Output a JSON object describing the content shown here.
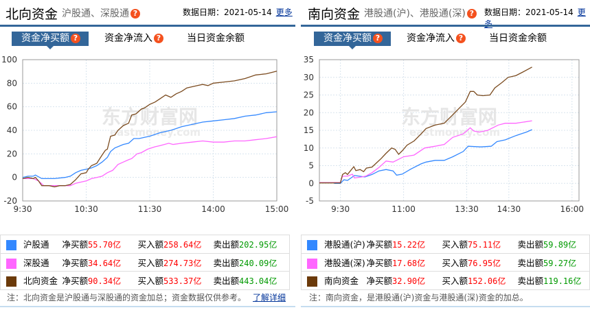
{
  "north": {
    "title": "北向资金",
    "subtitle": "沪股通、深股通",
    "date_label": "数据日期：2021-05-14",
    "more": "更多",
    "tabs": [
      "资金净买额",
      "资金净流入",
      "当日资金余额"
    ],
    "legend": [
      {
        "name": "沪股通",
        "net_label": "净买额",
        "net": "55.70亿",
        "buy_label": "买入额",
        "buy": "258.64亿",
        "sell_label": "卖出额",
        "sell": "202.95亿",
        "color": "#3388ff"
      },
      {
        "name": "深股通",
        "net_label": "净买额",
        "net": "34.64亿",
        "buy_label": "买入额",
        "buy": "274.73亿",
        "sell_label": "卖出额",
        "sell": "240.09亿",
        "color": "#ff66ff"
      },
      {
        "name": "北向资金",
        "net_label": "净买额",
        "net": "90.34亿",
        "buy_label": "买入额",
        "buy": "533.37亿",
        "sell_label": "卖出额",
        "sell": "443.04亿",
        "color": "#6b3a0a"
      }
    ],
    "note": "注：北向资金是沪股通与深股通的资金加总；资金数据仅供参考。",
    "note_link": "了解详细"
  },
  "south": {
    "title": "南向资金",
    "subtitle": "港股通(沪)、港股通(深)",
    "date_label": "数据日期：2021-05-14",
    "more": "更多",
    "tabs": [
      "资金净买额",
      "资金净流入",
      "当日资金余额"
    ],
    "legend": [
      {
        "name": "港股通(沪)",
        "net_label": "净买额",
        "net": "15.22亿",
        "buy_label": "买入额",
        "buy": "75.11亿",
        "sell_label": "卖出额",
        "sell": "59.89亿",
        "color": "#3388ff"
      },
      {
        "name": "港股通(深)",
        "net_label": "净买额",
        "net": "17.68亿",
        "buy_label": "买入额",
        "buy": "76.95亿",
        "sell_label": "卖出额",
        "sell": "59.27亿",
        "color": "#ff66ff"
      },
      {
        "name": "南向资金",
        "net_label": "净买额",
        "net": "32.90亿",
        "buy_label": "买入额",
        "buy": "152.06亿",
        "sell_label": "卖出额",
        "sell": "119.16亿",
        "color": "#6b3a0a"
      }
    ],
    "note": "注：南向资金，是港股通(沪)资金与港股通(深)资金的加总。"
  },
  "watermark": [
    "东方财富网",
    "eastmoney.com"
  ],
  "chart_data": [
    {
      "type": "line",
      "title": "北向资金 资金净买额",
      "ylim": [
        -20,
        100
      ],
      "yticks": [
        -20,
        0,
        20,
        40,
        60,
        80,
        100
      ],
      "xlim": [
        0,
        240
      ],
      "xticks": [
        {
          "x": 0,
          "label": "9:30"
        },
        {
          "x": 60,
          "label": "10:30"
        },
        {
          "x": 120,
          "label": "11:30"
        },
        {
          "x": 180,
          "label": "14:00"
        },
        {
          "x": 240,
          "label": "15:00"
        }
      ],
      "series": [
        {
          "name": "沪股通",
          "color": "#3388ff",
          "points": [
            [
              0,
              0
            ],
            [
              5,
              1
            ],
            [
              10,
              1
            ],
            [
              12,
              2
            ],
            [
              18,
              -1
            ],
            [
              30,
              -1
            ],
            [
              40,
              0
            ],
            [
              45,
              1
            ],
            [
              50,
              4
            ],
            [
              55,
              6
            ],
            [
              60,
              7
            ],
            [
              65,
              8
            ],
            [
              70,
              10
            ],
            [
              75,
              13
            ],
            [
              80,
              17
            ],
            [
              83,
              22
            ],
            [
              87,
              25
            ],
            [
              95,
              28
            ],
            [
              100,
              29
            ],
            [
              105,
              33
            ],
            [
              110,
              33
            ],
            [
              115,
              34
            ],
            [
              120,
              35
            ],
            [
              130,
              38
            ],
            [
              140,
              40
            ],
            [
              150,
              43
            ],
            [
              160,
              45
            ],
            [
              170,
              47
            ],
            [
              180,
              48
            ],
            [
              190,
              49
            ],
            [
              200,
              50
            ],
            [
              210,
              52
            ],
            [
              220,
              53
            ],
            [
              230,
              55
            ],
            [
              240,
              55.7
            ]
          ]
        },
        {
          "name": "深股通",
          "color": "#ff66ff",
          "points": [
            [
              0,
              -1
            ],
            [
              10,
              -1
            ],
            [
              15,
              -3
            ],
            [
              20,
              -7
            ],
            [
              35,
              -7
            ],
            [
              45,
              -7
            ],
            [
              50,
              -5
            ],
            [
              55,
              -4
            ],
            [
              60,
              -3
            ],
            [
              65,
              -1
            ],
            [
              70,
              0
            ],
            [
              75,
              1
            ],
            [
              80,
              4
            ],
            [
              85,
              6
            ],
            [
              90,
              11
            ],
            [
              95,
              13
            ],
            [
              100,
              15
            ],
            [
              103,
              16
            ],
            [
              108,
              20
            ],
            [
              112,
              21
            ],
            [
              118,
              24
            ],
            [
              125,
              26
            ],
            [
              130,
              27
            ],
            [
              138,
              29
            ],
            [
              142,
              28
            ],
            [
              150,
              29
            ],
            [
              160,
              30
            ],
            [
              170,
              31
            ],
            [
              180,
              30
            ],
            [
              190,
              30
            ],
            [
              200,
              31
            ],
            [
              210,
              31
            ],
            [
              220,
              32
            ],
            [
              230,
              33
            ],
            [
              240,
              34.6
            ]
          ]
        },
        {
          "name": "北向资金",
          "color": "#7a4a1e",
          "points": [
            [
              0,
              -1
            ],
            [
              5,
              0
            ],
            [
              10,
              -1
            ],
            [
              12,
              0
            ],
            [
              15,
              -3
            ],
            [
              18,
              -7
            ],
            [
              25,
              -7
            ],
            [
              30,
              -8
            ],
            [
              35,
              -7
            ],
            [
              40,
              -7
            ],
            [
              45,
              -6
            ],
            [
              50,
              -2
            ],
            [
              55,
              3
            ],
            [
              60,
              4
            ],
            [
              62,
              7
            ],
            [
              65,
              10
            ],
            [
              70,
              12
            ],
            [
              75,
              19
            ],
            [
              78,
              23
            ],
            [
              80,
              24
            ],
            [
              83,
              35
            ],
            [
              87,
              36
            ],
            [
              90,
              40
            ],
            [
              95,
              44
            ],
            [
              100,
              46
            ],
            [
              103,
              53
            ],
            [
              107,
              54
            ],
            [
              112,
              58
            ],
            [
              115,
              59
            ],
            [
              120,
              62
            ],
            [
              125,
              64
            ],
            [
              130,
              67
            ],
            [
              135,
              70
            ],
            [
              140,
              68
            ],
            [
              145,
              71
            ],
            [
              150,
              73
            ],
            [
              155,
              76
            ],
            [
              160,
              77
            ],
            [
              165,
              78
            ],
            [
              170,
              79
            ],
            [
              175,
              78
            ],
            [
              180,
              80
            ],
            [
              190,
              81
            ],
            [
              200,
              82
            ],
            [
              210,
              84
            ],
            [
              220,
              87
            ],
            [
              230,
              88
            ],
            [
              240,
              90.3
            ]
          ]
        }
      ]
    },
    {
      "type": "line",
      "title": "南向资金 资金净买额",
      "ylim": [
        -5,
        35
      ],
      "yticks": [
        -5,
        0,
        5,
        10,
        15,
        20,
        25,
        30,
        35
      ],
      "xlim": [
        0,
        370
      ],
      "xticks": [
        {
          "x": 30,
          "label": "9:30"
        },
        {
          "x": 120,
          "label": "11:00"
        },
        {
          "x": 210,
          "label": "13:30"
        },
        {
          "x": 270,
          "label": "14:30"
        },
        {
          "x": 360,
          "label": "16:00"
        }
      ],
      "series": [
        {
          "name": "港股通(沪)",
          "color": "#3388ff",
          "points": [
            [
              21,
              0
            ],
            [
              30,
              0
            ],
            [
              35,
              1
            ],
            [
              40,
              0.8
            ],
            [
              50,
              2.2
            ],
            [
              65,
              1.8
            ],
            [
              75,
              2.5
            ],
            [
              85,
              3.5
            ],
            [
              95,
              3.9
            ],
            [
              105,
              3.5
            ],
            [
              110,
              2.3
            ],
            [
              118,
              2.6
            ],
            [
              130,
              4
            ],
            [
              145,
              5.5
            ],
            [
              152,
              6
            ],
            [
              165,
              6.5
            ],
            [
              178,
              6.5
            ],
            [
              190,
              7.5
            ],
            [
              205,
              9
            ],
            [
              212,
              10.5
            ],
            [
              230,
              10.3
            ],
            [
              245,
              10.5
            ],
            [
              253,
              11.8
            ],
            [
              265,
              12.3
            ],
            [
              280,
              13.5
            ],
            [
              295,
              14.5
            ],
            [
              303,
              15.2
            ]
          ]
        },
        {
          "name": "港股通(深)",
          "color": "#ff66ff",
          "points": [
            [
              0,
              0.2
            ],
            [
              30,
              0.2
            ],
            [
              33,
              2
            ],
            [
              40,
              2
            ],
            [
              47,
              2.6
            ],
            [
              50,
              1.5
            ],
            [
              60,
              1.8
            ],
            [
              66,
              2
            ],
            [
              75,
              3
            ],
            [
              85,
              4.5
            ],
            [
              95,
              6.3
            ],
            [
              105,
              6
            ],
            [
              120,
              7.5
            ],
            [
              135,
              8
            ],
            [
              150,
              10
            ],
            [
              165,
              10.5
            ],
            [
              178,
              11
            ],
            [
              190,
              13
            ],
            [
              205,
              14
            ],
            [
              215,
              15.7
            ],
            [
              220,
              14.8
            ],
            [
              228,
              14.5
            ],
            [
              240,
              15
            ],
            [
              255,
              16.5
            ],
            [
              265,
              17
            ],
            [
              280,
              17
            ],
            [
              303,
              17.7
            ]
          ]
        },
        {
          "name": "南向资金",
          "color": "#7a4a1e",
          "points": [
            [
              0,
              0.1
            ],
            [
              30,
              0.1
            ],
            [
              33,
              2.5
            ],
            [
              37,
              3
            ],
            [
              40,
              2.5
            ],
            [
              49,
              4.7
            ],
            [
              52,
              3.6
            ],
            [
              58,
              3.9
            ],
            [
              63,
              3.3
            ],
            [
              67,
              4.3
            ],
            [
              75,
              4.6
            ],
            [
              80,
              5.5
            ],
            [
              88,
              7
            ],
            [
              95,
              8.5
            ],
            [
              103,
              10
            ],
            [
              108,
              9.6
            ],
            [
              113,
              8.2
            ],
            [
              118,
              9.2
            ],
            [
              125,
              10.8
            ],
            [
              135,
              12
            ],
            [
              145,
              14
            ],
            [
              152,
              15.5
            ],
            [
              165,
              16.5
            ],
            [
              178,
              17
            ],
            [
              188,
              19
            ],
            [
              198,
              21
            ],
            [
              208,
              23
            ],
            [
              215,
              26
            ],
            [
              220,
              26
            ],
            [
              225,
              25
            ],
            [
              233,
              24.8
            ],
            [
              243,
              25
            ],
            [
              250,
              27
            ],
            [
              260,
              28.5
            ],
            [
              269,
              30
            ],
            [
              280,
              30.5
            ],
            [
              290,
              31.5
            ],
            [
              303,
              32.9
            ]
          ]
        }
      ]
    }
  ]
}
